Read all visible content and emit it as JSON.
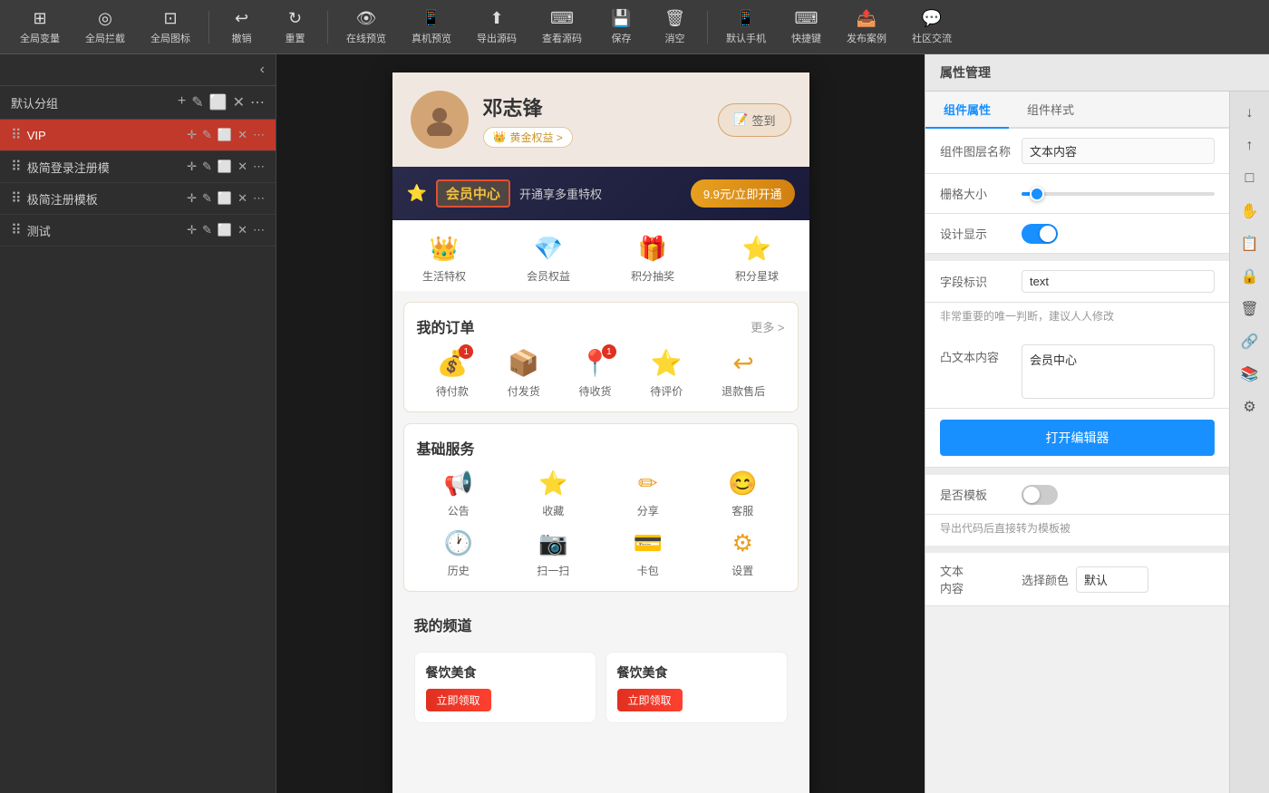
{
  "toolbar": {
    "items": [
      {
        "id": "global-var",
        "icon": "⊞",
        "label": "全局变量"
      },
      {
        "id": "global-intercept",
        "icon": "◎",
        "label": "全局拦截"
      },
      {
        "id": "global-icon",
        "icon": "⊡",
        "label": "全局图标"
      },
      {
        "id": "undo",
        "icon": "↩",
        "label": "撤销"
      },
      {
        "id": "reset",
        "icon": "↻",
        "label": "重置"
      },
      {
        "id": "online-preview",
        "icon": "👁",
        "label": "在线预览"
      },
      {
        "id": "real-preview",
        "icon": "📱",
        "label": "真机预览"
      },
      {
        "id": "export-source",
        "icon": "⬆",
        "label": "导出源码"
      },
      {
        "id": "view-source",
        "icon": "⌨",
        "label": "查看源码"
      },
      {
        "id": "save",
        "icon": "💾",
        "label": "保存"
      },
      {
        "id": "clear",
        "icon": "🗑",
        "label": "消空"
      },
      {
        "id": "default-phone",
        "icon": "📱",
        "label": "默认手机"
      },
      {
        "id": "shortcut",
        "icon": "⌨",
        "label": "快捷键"
      },
      {
        "id": "publish",
        "icon": "📤",
        "label": "发布案例"
      },
      {
        "id": "community",
        "icon": "💬",
        "label": "社区交流"
      }
    ]
  },
  "left_panel": {
    "title": "",
    "group_name": "默认分组",
    "layers": [
      {
        "id": "vip",
        "name": "VIP",
        "active": true
      },
      {
        "id": "login-reg",
        "name": "极简登录注册模",
        "active": false
      },
      {
        "id": "simple-reg",
        "name": "极简注册模板",
        "active": false
      },
      {
        "id": "test",
        "name": "测试",
        "active": false
      }
    ]
  },
  "phone_content": {
    "profile": {
      "name": "邓志锋",
      "vip_label": "黄金权益 >",
      "sign_btn": "签到"
    },
    "member_banner": {
      "title": "会员中心",
      "open_desc": "开通享多重特权",
      "open_price": "9.9元/立即开通"
    },
    "member_icons": [
      {
        "icon": "👑",
        "label": "生活特权"
      },
      {
        "icon": "💎",
        "label": "会员权益"
      },
      {
        "icon": "🎁",
        "label": "积分抽奖"
      },
      {
        "icon": "⭐",
        "label": "积分星球"
      }
    ],
    "order_section": {
      "title": "我的订单",
      "more": "更多 >",
      "items": [
        {
          "icon": "💰",
          "label": "待付款",
          "badge": "1"
        },
        {
          "icon": "📦",
          "label": "付发货",
          "badge": ""
        },
        {
          "icon": "📍",
          "label": "待收货",
          "badge": "1"
        },
        {
          "icon": "⭐",
          "label": "待评价",
          "badge": ""
        },
        {
          "icon": "↩",
          "label": "退款售后",
          "badge": ""
        }
      ]
    },
    "service_section": {
      "title": "基础服务",
      "items": [
        {
          "icon": "📢",
          "label": "公告"
        },
        {
          "icon": "⭐",
          "label": "收藏"
        },
        {
          "icon": "✏",
          "label": "分享"
        },
        {
          "icon": "😊",
          "label": "客服"
        },
        {
          "icon": "🕐",
          "label": "历史"
        },
        {
          "icon": "📷",
          "label": "扫一扫"
        },
        {
          "icon": "💳",
          "label": "卡包"
        },
        {
          "icon": "⚙",
          "label": "设置"
        }
      ]
    },
    "channel_section": {
      "title": "我的频道",
      "cards": [
        {
          "title": "餐饮美食"
        },
        {
          "title": "餐饮美食"
        }
      ]
    }
  },
  "right_panel": {
    "header": "属性管理",
    "tabs": [
      {
        "id": "component-props",
        "label": "组件属性",
        "active": true
      },
      {
        "id": "component-style",
        "label": "组件样式",
        "active": false
      }
    ],
    "icon_tools": [
      "↓",
      "↑",
      "□",
      "✋",
      "📋",
      "🔒",
      "🗑",
      "🔗",
      "📚",
      "⚙"
    ],
    "props": {
      "layer_name_label": "组件图层名称",
      "layer_name_value": "文本内容",
      "grid_size_label": "栅格大小",
      "design_display_label": "设计显示",
      "design_display_on": true,
      "field_id_label": "字段标识",
      "field_id_value": "text",
      "field_warning": "非常重要的唯一判断，建议人人修改",
      "text_content_label": "凸文本内容",
      "text_content_value": "会员中心",
      "open_editor_label": "打开编辑器",
      "is_template_label": "是否模板",
      "is_template_on": false,
      "export_desc": "导出代码后直接转为模板被",
      "text_content_color_label": "文本\n内容",
      "select_color_label": "选择颜色",
      "select_color_value": "默认"
    }
  }
}
